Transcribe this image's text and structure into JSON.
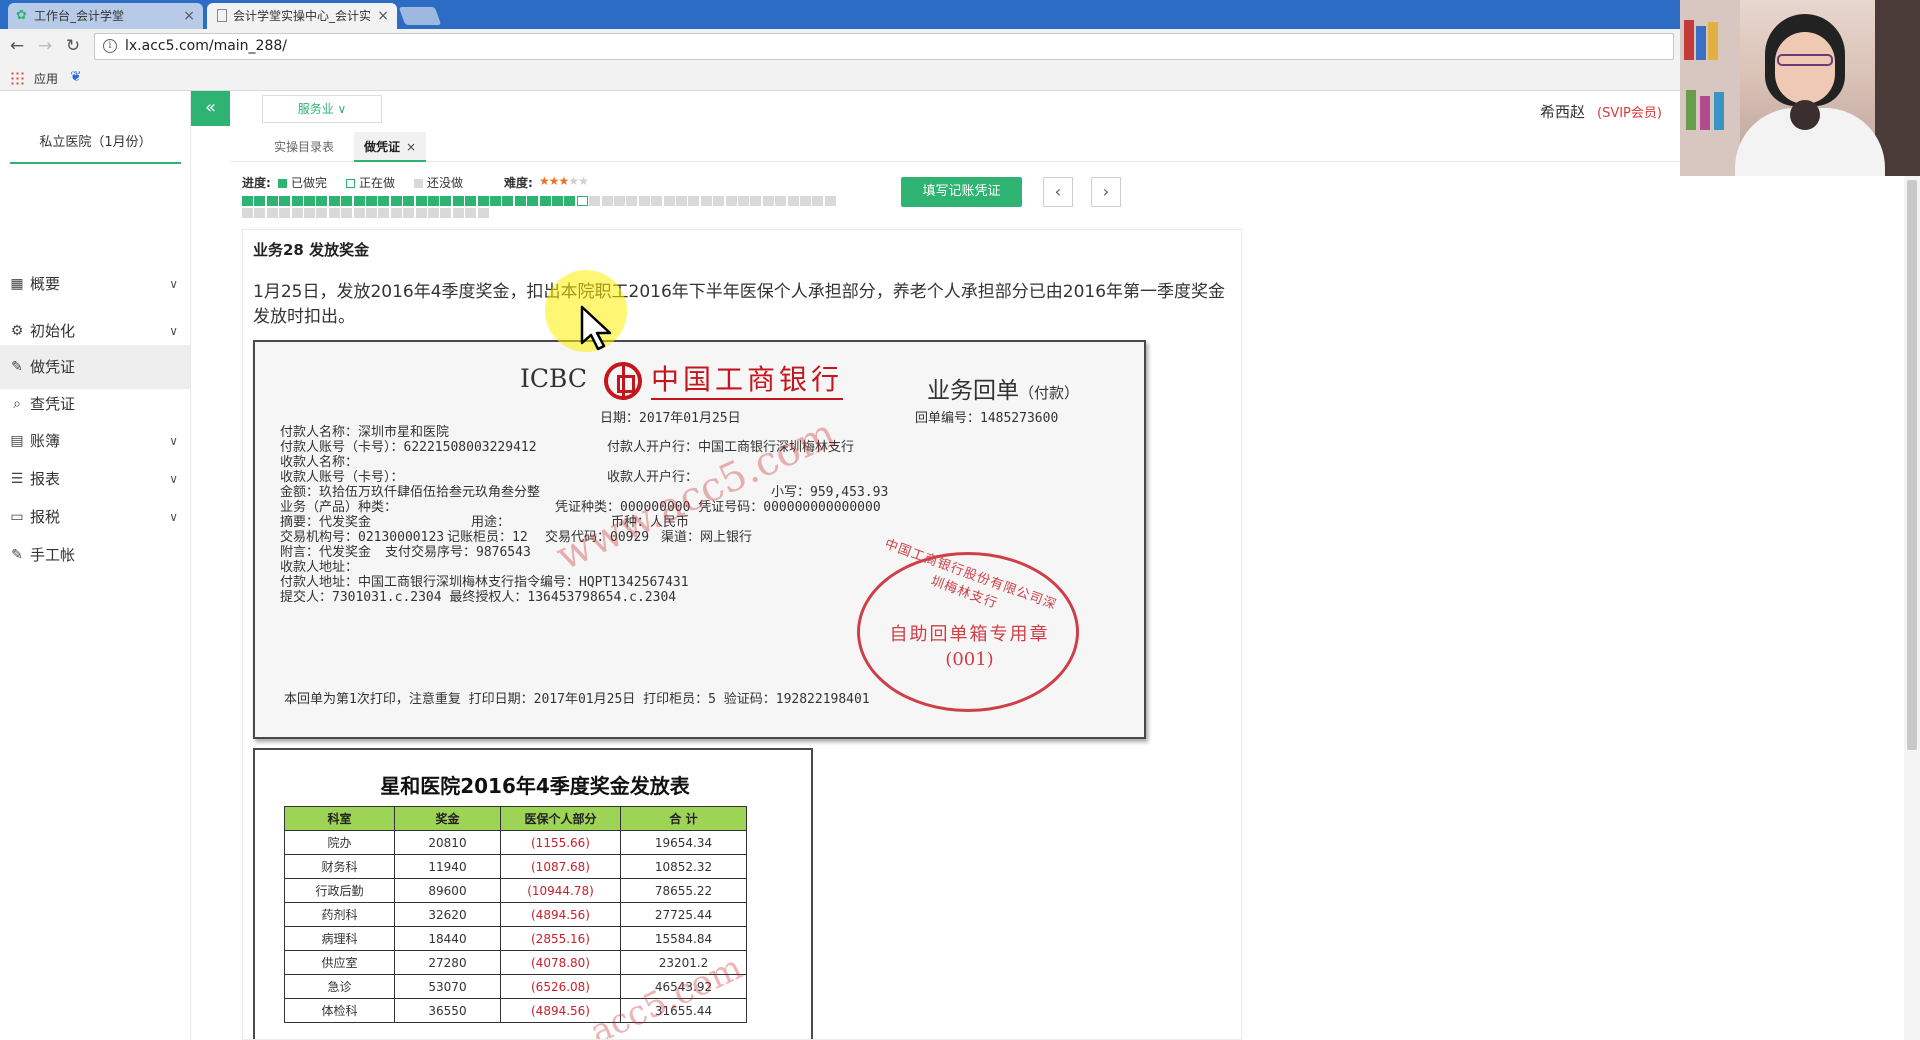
{
  "browser": {
    "tabs": [
      {
        "title": "工作台_会计学堂",
        "close": "×"
      },
      {
        "title": "会计学堂实操中心_会计实",
        "close": "×"
      }
    ],
    "url": "lx.acc5.com/main_288/",
    "bookmarks": {
      "apps_label": "应用"
    }
  },
  "app": {
    "company": "私立医院（1月份）",
    "collapse_icon": "«",
    "industry": "服务业 ∨",
    "user": {
      "name": "希西赵",
      "vip": "(SVIP会员)"
    },
    "menu": [
      {
        "label": "概要",
        "icon": "grid-icon",
        "expandable": true
      },
      {
        "label": "初始化",
        "icon": "gear-icon",
        "expandable": true
      },
      {
        "label": "做凭证",
        "icon": "pen-icon",
        "expandable": false,
        "active": true
      },
      {
        "label": "查凭证",
        "icon": "search-icon",
        "expandable": false
      },
      {
        "label": "账簿",
        "icon": "book-icon",
        "expandable": true
      },
      {
        "label": "报表",
        "icon": "report-icon",
        "expandable": true
      },
      {
        "label": "报税",
        "icon": "document-icon",
        "expandable": true
      },
      {
        "label": "手工帐",
        "icon": "pen-icon",
        "expandable": false
      }
    ],
    "subtabs": {
      "catalog": "实操目录表",
      "voucher": "做凭证",
      "voucher_close": "×"
    }
  },
  "progress": {
    "label": "进度:",
    "legend_done": "已做完",
    "legend_doing": "正在做",
    "legend_todo": "还没做",
    "difficulty_label": "难度:",
    "difficulty_stars": 3,
    "difficulty_max": 5,
    "total_tasks": 68,
    "done_tasks": 27,
    "current_task": 28,
    "write_voucher_button": "填写记账凭证",
    "prev": "‹",
    "next": "›"
  },
  "task": {
    "title": "业务28 发放奖金",
    "description": "1月25日，发放2016年4季度奖金，扣出本院职工2016年下半年医保个人承担部分，养老个人承担部分已由2016年第一季度奖金发放时扣出。"
  },
  "receipt": {
    "icbc": "ICBC",
    "bank_name": "中国工商银行",
    "title": "业务回单",
    "title_suffix": "（付款）",
    "date": "日期：2017年01月25日",
    "receipt_no": "回单编号：1485273600",
    "lines": {
      "payer_name": "付款人名称：深圳市星和医院",
      "payer_account": "付款人账号（卡号）：62221508003229412",
      "payer_bank": "付款人开户行：中国工商银行深圳梅林支行",
      "payee_name": "收款人名称：",
      "payee_account": "收款人账号（卡号）：",
      "payee_bank": "收款人开户行：",
      "amount_upper": "金额：玖拾伍万玖仟肆佰伍拾叁元玖角叁分整",
      "amount_lower": "小写：959,453.93",
      "product": "业务（产品）种类：",
      "voucher_type": "凭证种类：000000000 凭证号码：000000000000000",
      "summary": "摘要：代发奖金",
      "purpose": "用途：",
      "currency": "币种：人民币",
      "org_code": "交易机构号：02130000123",
      "teller": "记账柜员：12",
      "trade_code": "交易代码：00929",
      "channel": "渠道：网上银行",
      "note": "附言：代发奖金",
      "pay_seq": "支付交易序号：9876543",
      "payee_addr": "收款人地址：",
      "payer_addr": "付款人地址：中国工商银行深圳梅林支行指令编号：HQPT1342567431",
      "submitter": "提交人：7301031.c.2304  最终授权人：136453798654.c.2304",
      "footer": "本回单为第1次打印，注意重复   打印日期：2017年01月25日   打印柜员：5   验证码：192822198401"
    },
    "stamp": {
      "ring": "中国工商银行股份有限公司深圳梅林支行",
      "main": "自助回单箱专用章",
      "code": "(001)"
    },
    "watermark": "www.acc5.com"
  },
  "bonus_table": {
    "title": "星和医院2016年4季度奖金发放表",
    "headers": [
      "科室",
      "奖金",
      "医保个人部分",
      "合 计"
    ],
    "rows": [
      [
        "院办",
        "20810",
        "(1155.66)",
        "19654.34"
      ],
      [
        "财务科",
        "11940",
        "(1087.68)",
        "10852.32"
      ],
      [
        "行政后勤",
        "89600",
        "(10944.78)",
        "78655.22"
      ],
      [
        "药剂科",
        "32620",
        "(4894.56)",
        "27725.44"
      ],
      [
        "病理科",
        "18440",
        "(2855.16)",
        "15584.84"
      ],
      [
        "供应室",
        "27280",
        "(4078.80)",
        "23201.2"
      ],
      [
        "急诊",
        "53070",
        "(6526.08)",
        "46543.92"
      ],
      [
        "体检科",
        "36550",
        "(4894.56)",
        "31655.44"
      ]
    ],
    "watermark": "acc5.com"
  },
  "colors": {
    "accent": "#2fb372",
    "danger": "#c8202a",
    "icbc_red": "#c4161c",
    "chrome_blue": "#2d6cc4"
  }
}
